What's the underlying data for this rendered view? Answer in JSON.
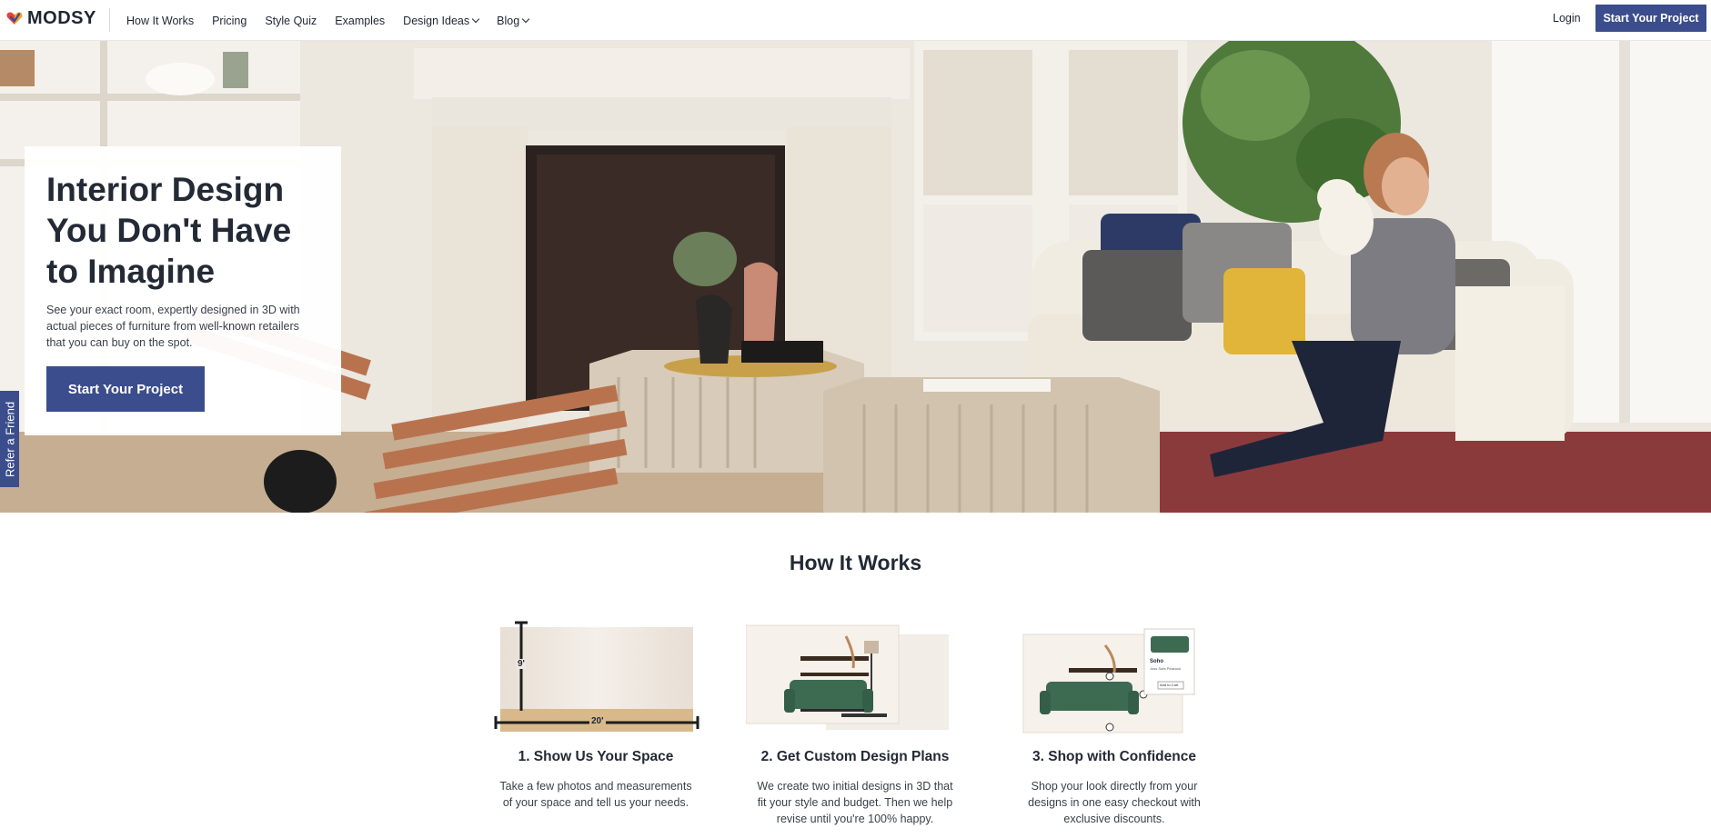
{
  "brand": {
    "name": "MODSY",
    "accent": "#3b4d8c"
  },
  "nav": {
    "items": [
      {
        "label": "How It Works",
        "dropdown": false
      },
      {
        "label": "Pricing",
        "dropdown": false
      },
      {
        "label": "Style Quiz",
        "dropdown": false
      },
      {
        "label": "Examples",
        "dropdown": false
      },
      {
        "label": "Design Ideas",
        "dropdown": true
      },
      {
        "label": "Blog",
        "dropdown": true
      }
    ],
    "login": "Login",
    "cta": "Start Your Project"
  },
  "hero": {
    "title": "Interior Design You Don't Have to Imagine",
    "subtitle": "See your exact room, expertly designed in 3D with actual pieces of furniture from well-known retailers that you can buy on the spot.",
    "cta": "Start Your Project"
  },
  "refer": "Refer a Friend",
  "how_it_works": {
    "title": "How It Works",
    "steps": [
      {
        "title": "1. Show Us Your Space",
        "description": "Take a few photos and measurements of your space and tell us your needs.",
        "height_label": "9'",
        "width_label": "20'"
      },
      {
        "title": "2. Get Custom Design Plans",
        "description": "We create two initial designs in 3D that fit your style and budget. Then we help revise until you're 100% happy."
      },
      {
        "title": "3. Shop with Confidence",
        "description": "Shop your look directly from your designs in one easy checkout with exclusive discounts.",
        "card_product": "Soho",
        "card_sub": "Joss Sofa Peacock",
        "card_button": "Add to Cart"
      }
    ]
  }
}
